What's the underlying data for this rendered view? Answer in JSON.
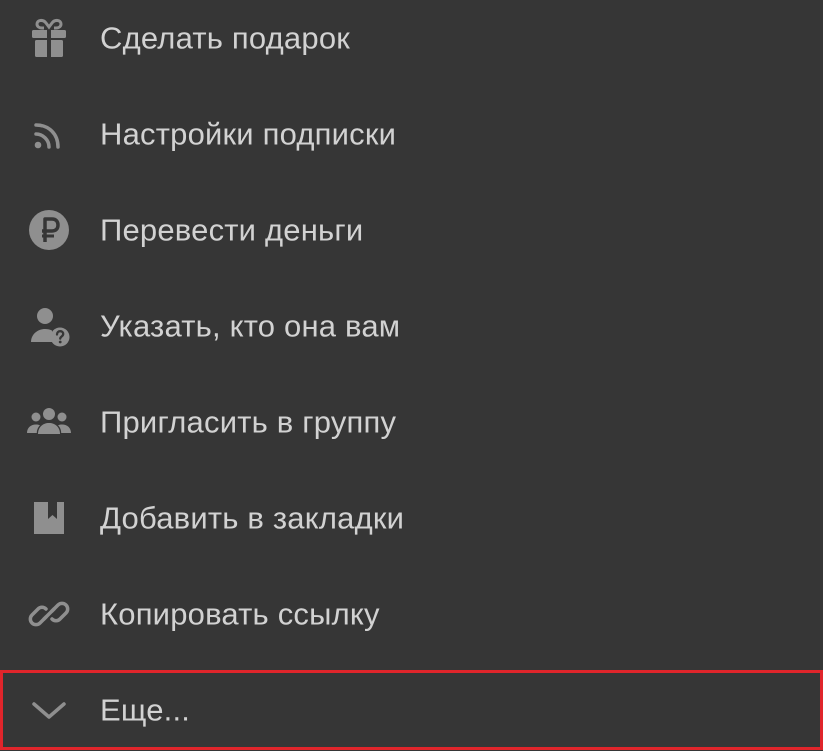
{
  "menu": {
    "items": [
      {
        "label": "Сделать подарок",
        "icon": "gift-icon"
      },
      {
        "label": "Настройки подписки",
        "icon": "rss-icon"
      },
      {
        "label": "Перевести деньги",
        "icon": "ruble-icon"
      },
      {
        "label": "Указать, кто она вам",
        "icon": "user-question-icon"
      },
      {
        "label": "Пригласить в группу",
        "icon": "group-icon"
      },
      {
        "label": "Добавить в закладки",
        "icon": "bookmark-icon"
      },
      {
        "label": "Копировать ссылку",
        "icon": "link-icon"
      },
      {
        "label": "Еще...",
        "icon": "chevron-down-icon",
        "highlighted": true
      }
    ]
  },
  "colors": {
    "background": "#363636",
    "text": "#d2d2d2",
    "icon": "#8f8f8f",
    "highlight": "#e0252b"
  }
}
